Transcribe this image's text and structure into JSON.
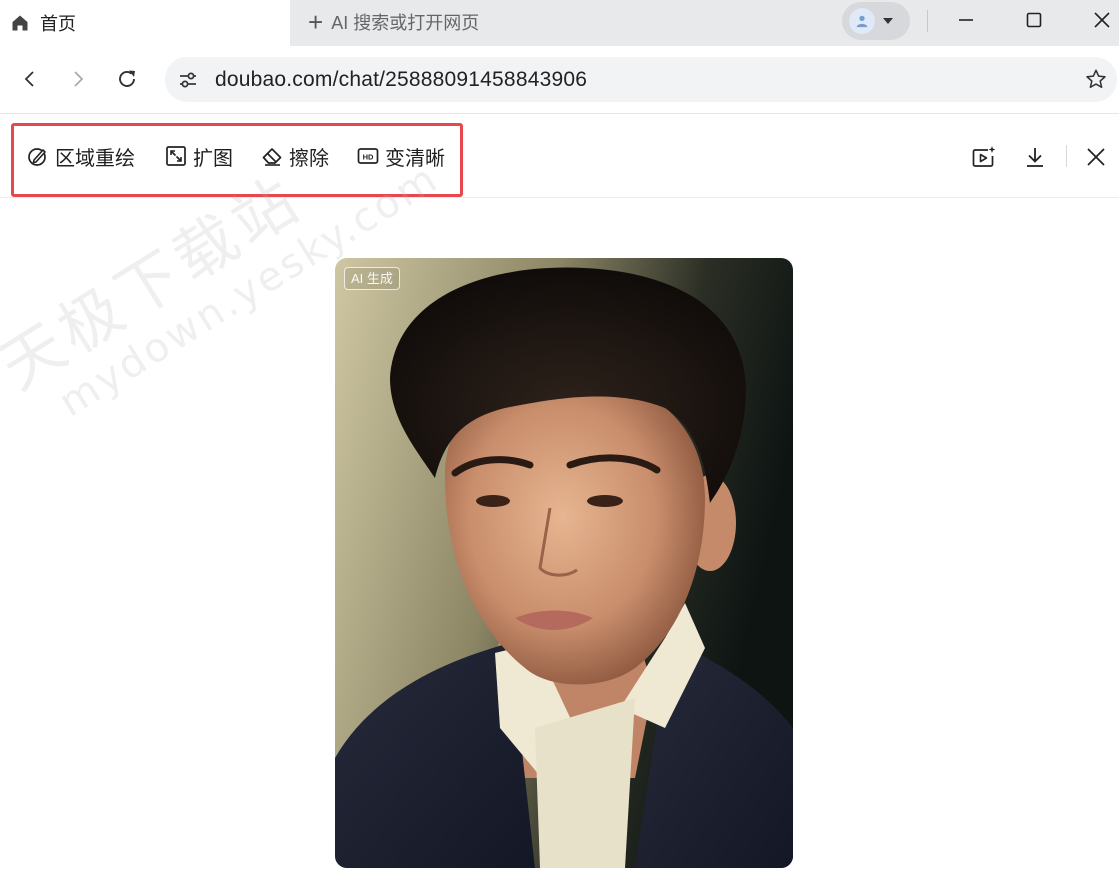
{
  "browser": {
    "tab": {
      "title": "首页",
      "icon": "home-icon"
    },
    "new_tab_label": "AI 搜索或打开网页",
    "profile_icon": "person-icon",
    "window_controls": [
      "minimize-icon",
      "maximize-icon",
      "close-icon"
    ],
    "address_bar": {
      "url": "doubao.com/chat/25888091458843906",
      "site_settings_icon": "tune-icon",
      "bookmark_icon": "star-icon"
    },
    "nav_icons": [
      "back-icon",
      "forward-icon",
      "reload-icon"
    ]
  },
  "editor": {
    "tools": [
      {
        "label": "区域重绘",
        "icon": "inpaint-icon"
      },
      {
        "label": "扩图",
        "icon": "expand-icon"
      },
      {
        "label": "擦除",
        "icon": "eraser-icon"
      },
      {
        "label": "变清晰",
        "icon": "hd-icon"
      }
    ],
    "highlight_color": "#e8474f",
    "right_actions": [
      "make-video-icon",
      "download-icon",
      "close-icon"
    ]
  },
  "image": {
    "badge": "AI 生成",
    "subject": "portrait photo of a young man in a dark jacket and white collared shirt"
  },
  "watermark": {
    "cn": "天极下载站",
    "en": "mydown.yesky.com"
  }
}
